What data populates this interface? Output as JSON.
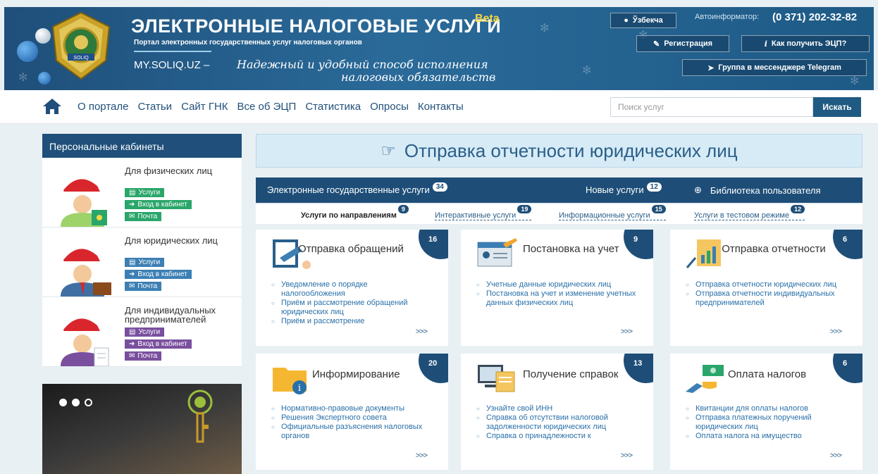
{
  "header": {
    "site_title": "ЭЛЕКТРОННЫЕ НАЛОГОВЫЕ УСЛУГИ",
    "beta": "Beta",
    "subtitle": "Портал электронных государственных услуг налоговых органов",
    "site_url": "MY.SOLIQ.UZ",
    "slogan_dash": "–",
    "slogan_line1": "Надежный и удобный способ исполнения",
    "slogan_line2": "налоговых обязательств",
    "language_label": "Ўзбекча",
    "informator_label": "Автоинформатор:",
    "informator_phone": "(0 371) 202-32-82",
    "register_label": "Регистрация",
    "eds_label": "Как получить ЭЦП?",
    "telegram_label": "Группа в мессенджере Telegram",
    "emblem_text": "SOLIQ"
  },
  "nav": {
    "items": [
      "О портале",
      "Статьи",
      "Сайт ГНК",
      "Все об ЭЦП",
      "Статистика",
      "Опросы",
      "Контакты"
    ],
    "search_placeholder": "Поиск услуг",
    "search_button": "Искать"
  },
  "sidebar": {
    "title": "Персональные кабинеты",
    "cabinets": [
      {
        "title": "Для физических лиц",
        "services": "Услуги",
        "login": "Вход в кабинет",
        "mail": "Почта",
        "color": "#2aa66a"
      },
      {
        "title": "Для юридических лиц",
        "services": "Услуги",
        "login": "Вход в кабинет",
        "mail": "Почта",
        "color": "#3c7fb4"
      },
      {
        "title": "Для индивидуальных предпринимателей",
        "services": "Услуги",
        "login": "Вход в кабинет",
        "mail": "Почта",
        "color": "#7a4f9e"
      }
    ]
  },
  "main": {
    "title": "Отправка отчетности юридических лиц",
    "tabs": [
      {
        "label": "Электронные государственные услуги",
        "count": "34"
      },
      {
        "label": "Новые услуги",
        "count": "12"
      },
      {
        "label": "Библиотека пользователя"
      }
    ],
    "sub_tabs": [
      {
        "label": "Услуги по направлениям",
        "count": "9"
      },
      {
        "label": "Интерактивные услуги",
        "count": "19"
      },
      {
        "label": "Информационные услуги",
        "count": "15"
      },
      {
        "label": "Услуги в тестовом режиме",
        "count": "12"
      }
    ],
    "cards": [
      {
        "title": "Отправка обращений",
        "count": "16",
        "more": ">>>",
        "items": [
          "Уведомление о порядке налогообложения",
          "Приём и рассмотрение обращений юридических лиц",
          "Приём и рассмотрение"
        ]
      },
      {
        "title": "Постановка на учет",
        "count": "9",
        "more": ">>>",
        "items": [
          "Учетные данные юридических лиц",
          "Постановка на учет и изменение учетных данных физических лиц"
        ]
      },
      {
        "title": "Отправка отчетности",
        "count": "6",
        "more": ">>>",
        "items": [
          "Отправка отчетности юридических лиц",
          "Отправка отчетности индивидуальных предпринимателей"
        ]
      },
      {
        "title": "Информирование",
        "count": "20",
        "more": ">>>",
        "items": [
          "Нормативно-правовые документы",
          "Решения Экспертного совета",
          "Официальные разъяснения налоговых органов"
        ]
      },
      {
        "title": "Получение справок",
        "count": "13",
        "more": ">>>",
        "items": [
          "Узнайте свой ИНН",
          "Справка об отсутствии налоговой задолженности юридических лиц",
          "Справка о принадлежности к"
        ]
      },
      {
        "title": "Оплата налогов",
        "count": "6",
        "more": ">>>",
        "items": [
          "Квитанции для оплаты налогов",
          "Отправка платежных поручений юридических лиц",
          "Оплата налога на имущество"
        ]
      }
    ]
  },
  "colors": {
    "brand": "#1f4f7a",
    "accent": "#2a70a8",
    "green": "#2aa66a",
    "purple": "#7a4f9e"
  }
}
